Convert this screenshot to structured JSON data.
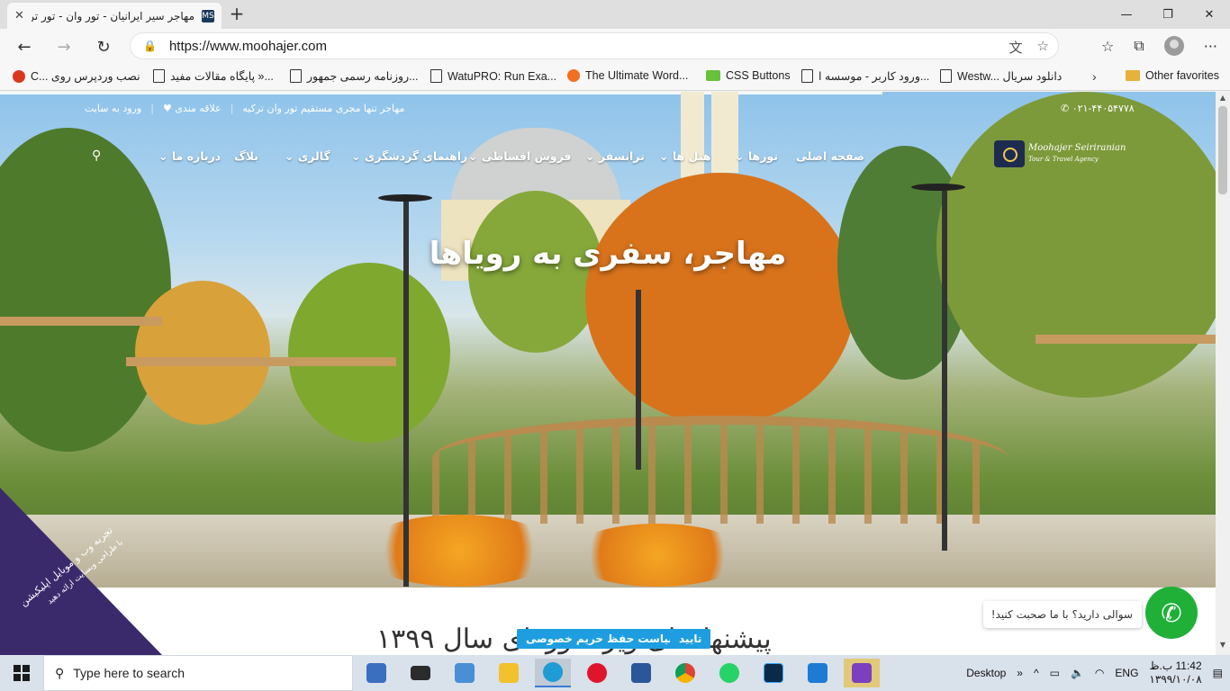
{
  "browser": {
    "tab_title": "مهاجر سیر ایرانیان - تور وان - تور تر",
    "tab_favicon": "MS",
    "url": "https://www.moohajer.com",
    "favorites": [
      {
        "label": "C... نصب وردپرس روی",
        "icon": "red"
      },
      {
        "label": "پایگاه مقالات مفید »...",
        "icon": "page"
      },
      {
        "label": "روزنامه رسمی جمهور...",
        "icon": "page"
      },
      {
        "label": "WatuPRO: Run Exa...",
        "icon": "page"
      },
      {
        "label": "The Ultimate Word...",
        "icon": "orange"
      },
      {
        "label": "CSS Buttons",
        "icon": "green"
      },
      {
        "label": "ورود کاربر - موسسه ا...",
        "icon": "page"
      },
      {
        "label": "Westw... دانلود سریال",
        "icon": "page"
      }
    ],
    "other_favorites": "Other favorites"
  },
  "site": {
    "phone": "۰۲۱-۴۴۰۵۴۷۷۸",
    "top_links": {
      "tagline": "مهاجر تنها مجری مستقیم تور وان ترکیه",
      "wishlist": "علاقه مندی",
      "login": "ورود به سایت"
    },
    "logo_title": "Moohajer Seiriranian",
    "logo_subtitle": "Tour & Travel Agency",
    "nav": {
      "home": "صفحه اصلی",
      "tours": "تورها",
      "hotels": "هتل ها",
      "transfer": "ترانسفر",
      "ticket": "فروش اقساطی",
      "guide": "راهنمای گردشگری",
      "gallery": "گالری",
      "blog": "بلاگ",
      "about": "درباره ما"
    },
    "hero_title": "مهاجر، سفری به رویاها",
    "section_title": "پیشنهادهای ویژه تورهای سال ۱۳۹۹",
    "corner_badge": "تجربه وب و موبایل اپلیکیشن",
    "corner_sub": "با طراحی وبسایت ارائه دهید",
    "chat_prompt": "سوالی دارید؟ با ما صحبت کنید!",
    "privacy_label": "سیاست حفظ حریم خصوصی",
    "accept_label": "تایید"
  },
  "taskbar": {
    "search_placeholder": "Type here to search",
    "desktop_label": "Desktop",
    "lang": "ENG",
    "time": "11:42 ب.ظ",
    "date": "۱۳۹۹/۱۰/۰۸",
    "apps": [
      "store",
      "mail",
      "explorer-pc",
      "file-explorer",
      "edge",
      "opera",
      "word",
      "chrome",
      "whatsapp",
      "photoshop",
      "remote",
      "visual-studio"
    ]
  },
  "colors": {
    "nav_green": "#20b038",
    "accent_blue": "#1e9ee0",
    "badge_purple": "#3b2a6b"
  }
}
